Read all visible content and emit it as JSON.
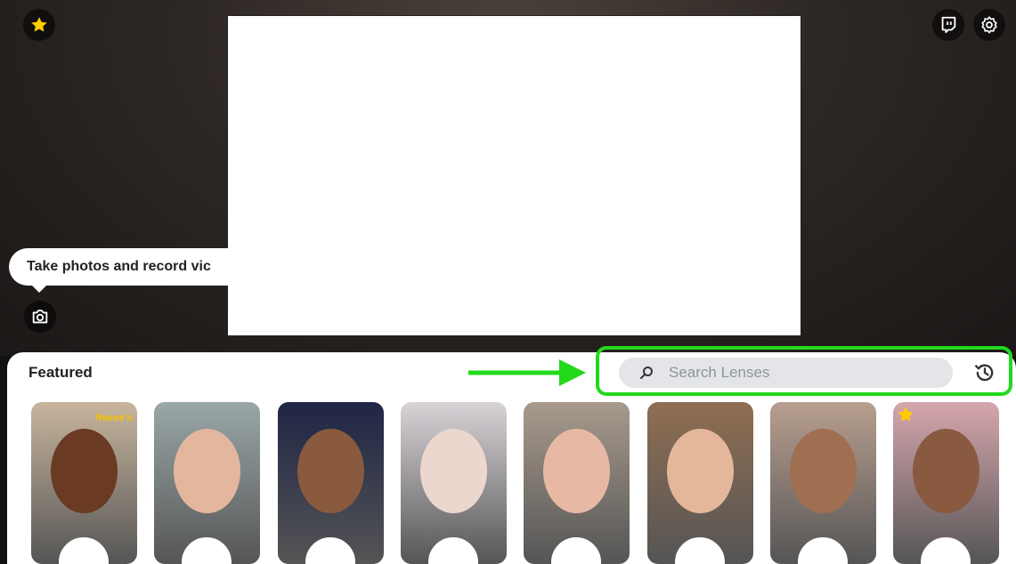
{
  "topbar": {
    "favorite_icon": "star-icon",
    "twitch_icon": "twitch-icon",
    "settings_icon": "gear-icon"
  },
  "tooltip": {
    "text": "Take photos and record vic"
  },
  "camera_button": {
    "icon": "camera-icon"
  },
  "tray": {
    "section_title": "Featured",
    "search": {
      "placeholder": "Search Lenses"
    },
    "history_icon": "history-icon"
  },
  "lenses": [
    {
      "name": "lens-1",
      "label": "Reese's",
      "bg": "#c8b59d",
      "face": "#6a3a22"
    },
    {
      "name": "lens-2",
      "bg": "#9aa7a8",
      "face": "#e2b79e"
    },
    {
      "name": "lens-3",
      "bg": "#1f2545",
      "face": "#8a5a3e"
    },
    {
      "name": "lens-4",
      "bg": "#d9d3d8",
      "face": "#ecd7cf"
    },
    {
      "name": "lens-5",
      "bg": "#a79a8c",
      "face": "#e7b9a4"
    },
    {
      "name": "lens-6",
      "bg": "#8f6e52",
      "face": "#e5b79a"
    },
    {
      "name": "lens-7",
      "bg": "#b89f8f",
      "face": "#a06e50"
    },
    {
      "name": "lens-8",
      "bg": "#d5a6ad",
      "face": "#8a5a40",
      "favorite": true
    }
  ],
  "colors": {
    "highlight": "#23d91b",
    "star": "#ffcc00"
  }
}
